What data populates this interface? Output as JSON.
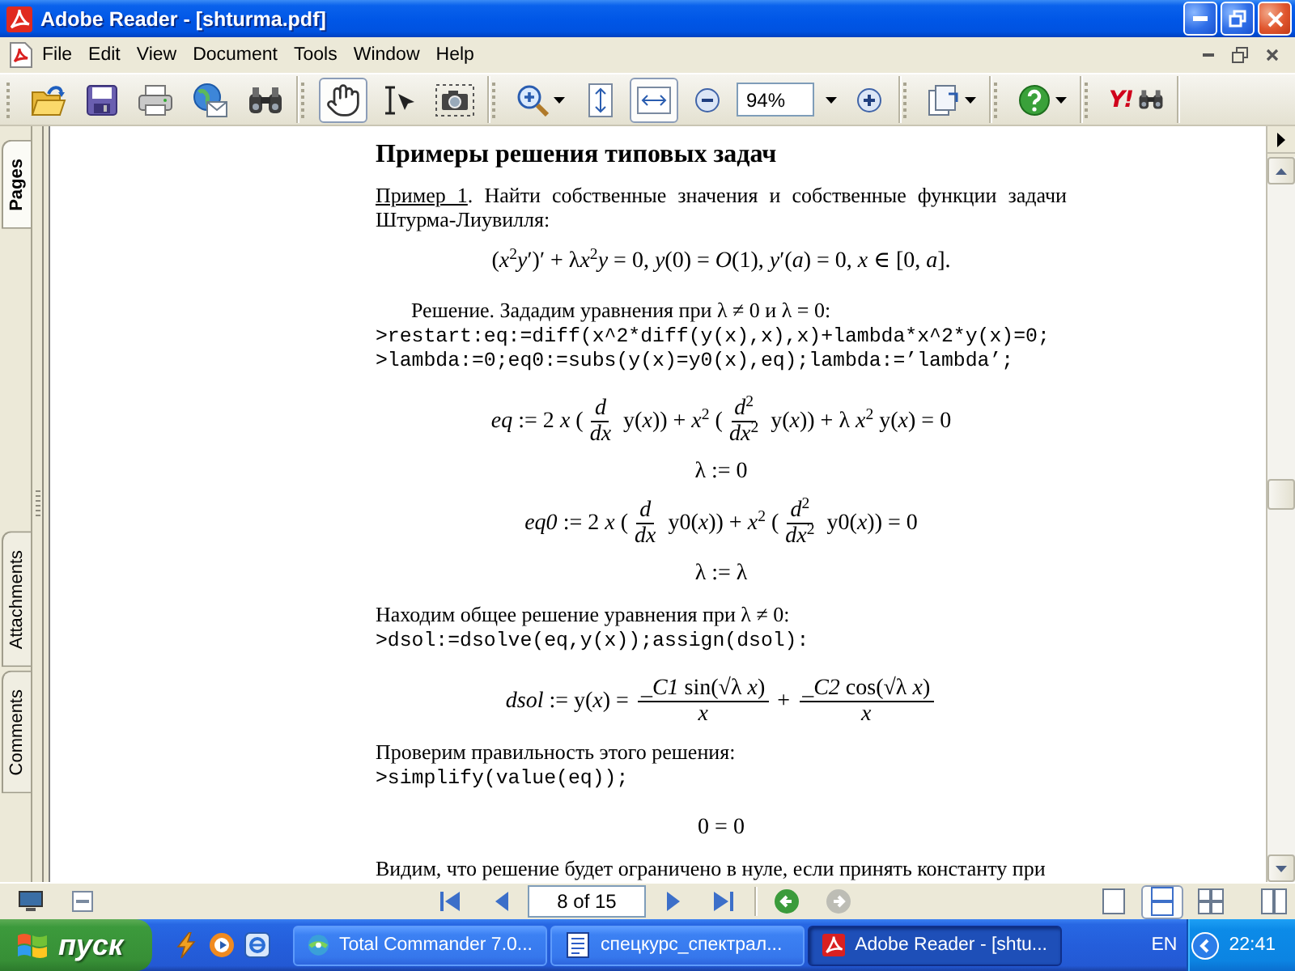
{
  "window": {
    "title": "Adobe Reader - [shturma.pdf]"
  },
  "menu": [
    "File",
    "Edit",
    "View",
    "Document",
    "Tools",
    "Window",
    "Help"
  ],
  "toolbar": {
    "groups": [
      [
        {
          "kind": "open"
        },
        {
          "kind": "save"
        },
        {
          "kind": "print"
        },
        {
          "kind": "email"
        },
        {
          "kind": "search"
        }
      ],
      [
        {
          "kind": "hand",
          "selected": true
        },
        {
          "kind": "select",
          "selected": false
        },
        {
          "kind": "snapshot",
          "selected": false
        }
      ],
      [
        {
          "kind": "zoom_tool",
          "selected": false
        },
        {
          "kind": "fit_page",
          "selected": false
        },
        {
          "kind": "fit_width",
          "selected": true
        },
        {
          "kind": "zoom_out"
        },
        {
          "kind": "zoom_field",
          "value": "94%"
        },
        {
          "kind": "zoom_in"
        }
      ],
      [
        {
          "kind": "pages"
        }
      ],
      [
        {
          "kind": "help"
        }
      ],
      [
        {
          "kind": "web_search",
          "text": "Y!"
        }
      ]
    ]
  },
  "side_tabs": {
    "top": [
      {
        "label": "Pages",
        "selected": true
      }
    ],
    "bottom": [
      {
        "label": "Attachments",
        "selected": false
      },
      {
        "label": "Comments",
        "selected": false
      }
    ]
  },
  "document": {
    "heading": "Примеры решения типовых задач",
    "blocks": [
      {
        "kind": "para",
        "lead": "Пример 1",
        "text": ". Найти собственные значения и собственные функции задачи Штурма-Лиувилля:",
        "indent": false
      },
      {
        "kind": "formula",
        "parts": [
          {
            "kind": "text",
            "text": "(*x*$^{2}$*y*′)′ + λ"
          },
          {
            "kind": "text",
            "text": "*x*$^{2}$*y* = 0, *y*(0) = *O*(1), *y*′(*a*) = 0, *x* ∈ [0, *a*]."
          }
        ]
      },
      {
        "kind": "para",
        "text": "Решение. Зададим уравнения при λ ≠ 0 и λ = 0:",
        "indent": true
      },
      {
        "kind": "code",
        "text": ">restart:eq:=diff(x^2*diff(y(x),x),x)+lambda*x^2*y(x)=0;"
      },
      {
        "kind": "code",
        "text": ">lambda:=0;eq0:=subs(y(x)=y0(x),eq);lambda:=’lambda’;"
      },
      {
        "kind": "formula",
        "parts": [
          {
            "kind": "text",
            "text": "*eq* := 2 *x* ("
          },
          {
            "kind": "frac",
            "num": [
              "*d*"
            ],
            "den": [
              "*dx*"
            ]
          },
          {
            "kind": "text",
            "text": " y(*x*)) + *x*$^{2}$ ("
          },
          {
            "kind": "frac",
            "num": [
              "*d*$^{2}$"
            ],
            "den": [
              "*dx*$^{2}$"
            ]
          },
          {
            "kind": "text",
            "text": " y(*x*)) + λ *x*$^{2}$ y(*x*) = 0"
          }
        ]
      },
      {
        "kind": "formula",
        "parts": [
          {
            "kind": "text",
            "text": "λ := 0"
          }
        ]
      },
      {
        "kind": "formula",
        "parts": [
          {
            "kind": "text",
            "text": "*eq0* := 2 *x* ("
          },
          {
            "kind": "frac",
            "num": [
              "*d*"
            ],
            "den": [
              "*dx*"
            ]
          },
          {
            "kind": "text",
            "text": " y0(*x*)) + *x*$^{2}$ ("
          },
          {
            "kind": "frac",
            "num": [
              "*d*$^{2}$"
            ],
            "den": [
              "*dx*$^{2}$"
            ]
          },
          {
            "kind": "text",
            "text": " y0(*x*)) = 0"
          }
        ]
      },
      {
        "kind": "formula",
        "parts": [
          {
            "kind": "text",
            "text": "λ := λ"
          }
        ]
      },
      {
        "kind": "para",
        "text": "Находим общее решение уравнения при λ ≠ 0:",
        "indent": false
      },
      {
        "kind": "code",
        "text": ">dsol:=dsolve(eq,y(x));assign(dsol):"
      },
      {
        "kind": "formula",
        "parts": [
          {
            "kind": "text",
            "text": "*dsol* := y(*x*) = "
          },
          {
            "kind": "frac",
            "num": [
              "_",
              "*C1* sin(√λ *x*)"
            ],
            "den": [
              "*x*"
            ]
          },
          {
            "kind": "text",
            "text": " + "
          },
          {
            "kind": "frac",
            "num": [
              "_",
              "*C2* cos(√λ *x*)"
            ],
            "den": [
              "*x*"
            ]
          }
        ]
      },
      {
        "kind": "para",
        "text": "Проверим правильность этого решения:",
        "indent": false
      },
      {
        "kind": "code",
        "text": ">simplify(value(eq));"
      },
      {
        "kind": "formula",
        "parts": [
          {
            "kind": "text",
            "text": "0 = 0"
          }
        ]
      },
      {
        "kind": "para",
        "text": "Видим, что решение будет ограничено в нуле, если принять константу при",
        "indent": false
      }
    ]
  },
  "page_nav": {
    "page_field": "8 of 15",
    "history": [
      {
        "kind": "back",
        "disabled": false
      },
      {
        "kind": "forward",
        "disabled": true
      }
    ],
    "layouts": [
      {
        "kind": "single",
        "selected": false
      },
      {
        "kind": "continuous",
        "selected": true
      },
      {
        "kind": "facing",
        "selected": false
      },
      {
        "kind": "continuous_facing",
        "selected": false
      }
    ]
  },
  "taskbar": {
    "start": "пуск",
    "tasks": [
      {
        "kind": "commander",
        "label": "Total Commander 7.0...",
        "selected": false
      },
      {
        "kind": "word",
        "label": "спецкурс_спектрал...",
        "selected": false
      },
      {
        "kind": "reader",
        "label": "Adobe Reader - [shtu...",
        "selected": true
      }
    ],
    "language": "EN",
    "clock": "22:41"
  }
}
